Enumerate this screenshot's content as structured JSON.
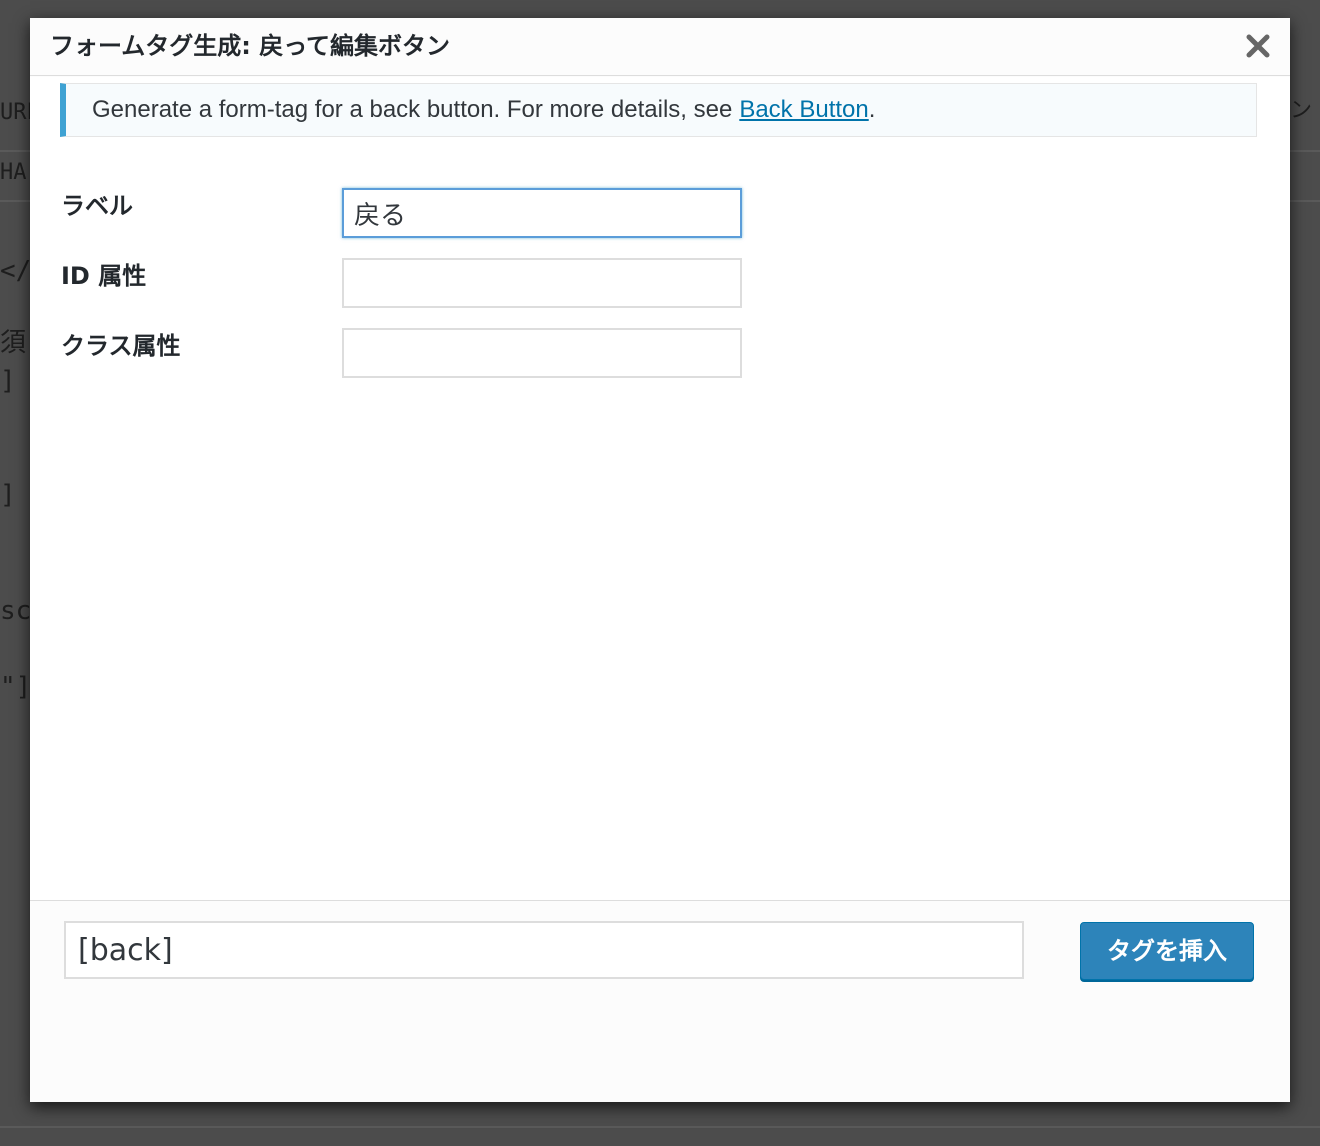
{
  "background": {
    "left_fragments": [
      "URL",
      "HA",
      "</",
      "須",
      "]",
      "]",
      "sc",
      "\"]"
    ],
    "right_fragments": [
      "ン"
    ]
  },
  "dialog": {
    "title": "フォームタグ生成: 戻って編集ボタン",
    "close_icon": "close-icon"
  },
  "notice": {
    "text": "Generate a form-tag for a back button. For more details, see",
    "link_text": "Back Button",
    "trailing": ".",
    "accent_color": "#3fa2d3"
  },
  "fields": [
    {
      "label": "ラベル",
      "value": "戻る",
      "focused": true
    },
    {
      "label": "ID 属性",
      "value": ""
    },
    {
      "label": "クラス属性",
      "value": ""
    }
  ],
  "footer": {
    "tag_value": "[back]",
    "insert_button_label": "タグを挿入",
    "button_color": "#2d84ba"
  }
}
